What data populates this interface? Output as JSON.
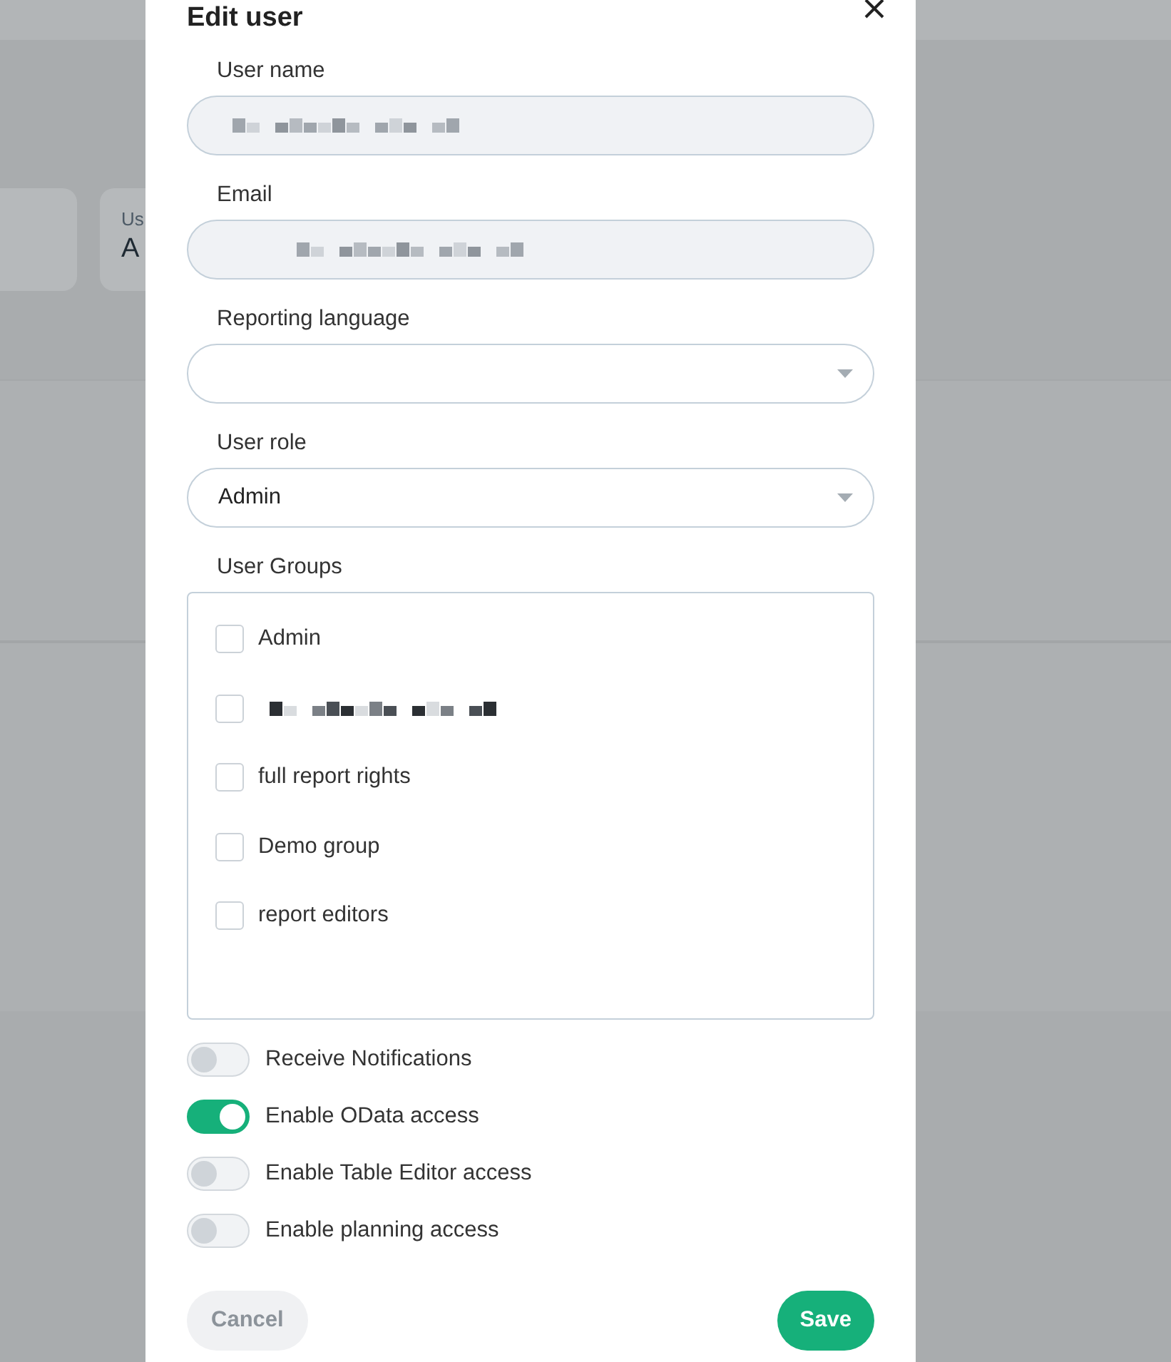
{
  "background": {
    "card_texts": [
      "Us",
      "A"
    ]
  },
  "dialog": {
    "title": "Edit user",
    "fields": [
      {
        "label": "User name",
        "kind": "redacted"
      },
      {
        "label": "Email",
        "kind": "redacted"
      },
      {
        "label": "Reporting language",
        "kind": "select"
      },
      {
        "label": "User role",
        "kind": "select",
        "value": "Admin"
      }
    ],
    "groups": {
      "label": "User Groups",
      "items": [
        {
          "label": "Admin",
          "checked": false
        },
        {
          "kind": "redacted",
          "checked": false
        },
        {
          "label": "full report rights",
          "checked": false
        },
        {
          "label": "Demo group",
          "checked": false
        },
        {
          "label": "report editors",
          "checked": false
        }
      ]
    },
    "toggles": [
      {
        "label": "Receive Notifications",
        "on": false
      },
      {
        "label": "Enable OData access",
        "on": true
      },
      {
        "label": "Enable Table Editor access",
        "on": false
      },
      {
        "label": "Enable planning access",
        "on": false
      }
    ],
    "cancel": "Cancel",
    "save": "Save"
  }
}
